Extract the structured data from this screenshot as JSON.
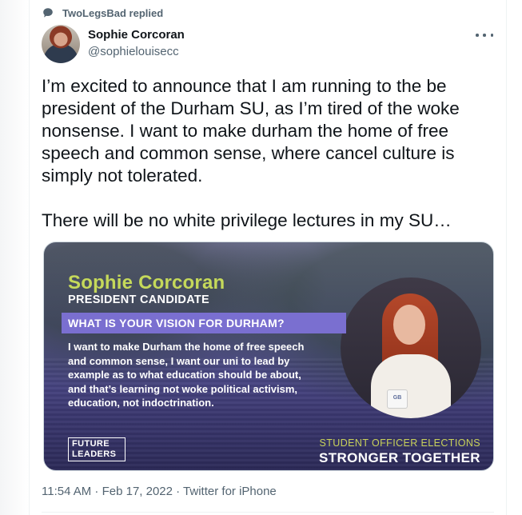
{
  "retweet": {
    "icon": "speech-bubble-icon",
    "text": "TwoLegsBad replied"
  },
  "author": {
    "name": "Sophie Corcoran",
    "handle": "@sophielouisecc"
  },
  "tweet": {
    "paragraphs": [
      "I’m excited to announce that I am running to the be president of the Durham SU, as I’m tired of the woke nonsense. I want to make durham the home of free speech and common sense, where cancel culture is simply not tolerated.",
      "There will be no white privilege lectures in my SU…"
    ]
  },
  "media": {
    "candidate_name": "Sophie Corcoran",
    "candidate_role": "PRESIDENT CANDIDATE",
    "question": "WHAT IS YOUR VISION FOR DURHAM?",
    "quote": "I want to make Durham the home of free speech and common sense, I want our uni to lead by example as to what education should be about, and that’s learning not woke political activism, education, not indoctrination.",
    "future_leaders_line1": "FUTURE",
    "future_leaders_line2": "LEADERS",
    "elections": "STUDENT OFFICER ELECTIONS",
    "slogan": "STRONGER TOGETHER",
    "mug_text": "GB"
  },
  "meta": {
    "timestamp": "11:54 AM · Feb 17, 2022 · Twitter for iPhone"
  },
  "colors": {
    "text_primary": "#0f1419",
    "text_secondary": "#536471",
    "accent_green": "#c5d95a",
    "bar_purple": "#7a6fd0"
  }
}
